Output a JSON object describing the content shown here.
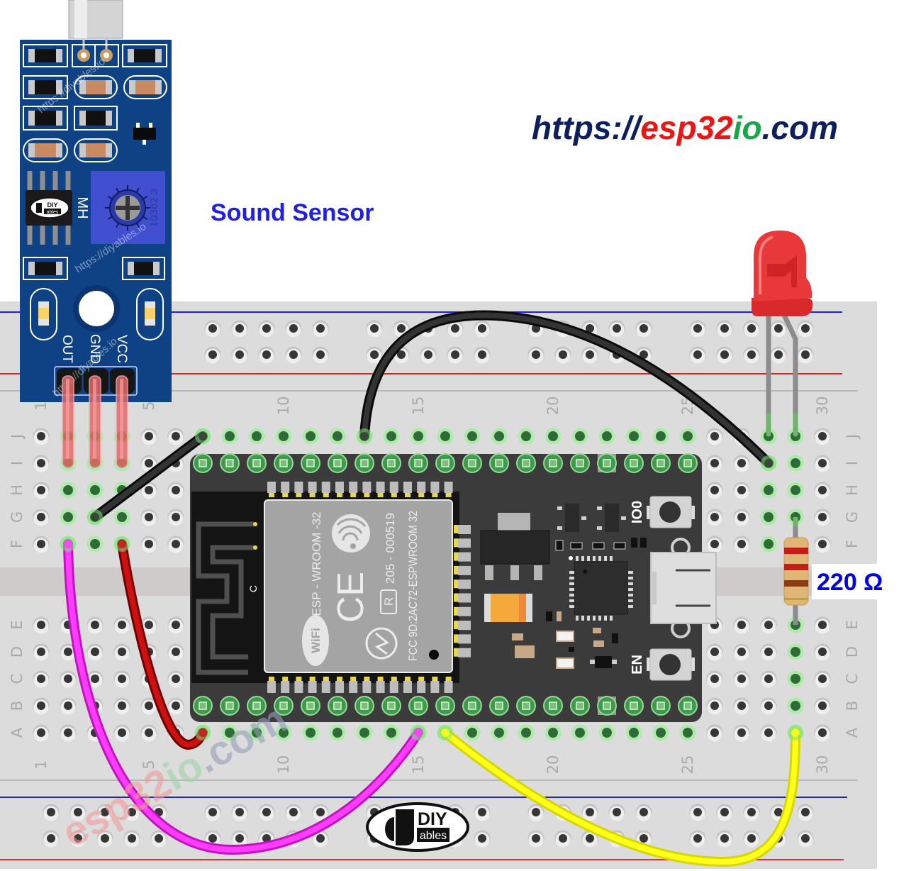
{
  "header": {
    "url": {
      "scheme": "https://",
      "brand": "esp32",
      "suffix": "io",
      "tld": ".com"
    }
  },
  "labels": {
    "sound_sensor": "Sound Sensor",
    "resistor_value": "220 Ω"
  },
  "breadboard": {
    "column_labels": [
      "1",
      "5",
      "10",
      "15",
      "20",
      "25",
      "30"
    ],
    "rows_top": [
      "J",
      "I",
      "H",
      "G",
      "F"
    ],
    "rows_bottom": [
      "E",
      "D",
      "C",
      "B",
      "A"
    ]
  },
  "sensor": {
    "pins": [
      "OUT",
      "GND",
      "VCC"
    ],
    "chip_marking": "MH",
    "pot_marking": "10362 3",
    "chip_logo": {
      "top": "DIY",
      "bottom": "ables"
    },
    "watermark": "https://diyables.io"
  },
  "esp32": {
    "module": "ESP - WROOM -32",
    "cert": "205 - 000519",
    "fcc": "FCC 9D:2AC72-ESPWROOM 32",
    "r_mark": "R",
    "ce_mark": "CE",
    "antenna_mark": "C",
    "wifi": "WiFi",
    "button_boot": "IO0",
    "button_reset": "EN"
  },
  "logo": {
    "top": "DIY",
    "bottom": "ables"
  },
  "watermark": {
    "brand": "esp32",
    "suffix": "io",
    "tld": ".com"
  },
  "circuit": {
    "sensor_pins": {
      "OUT": "I2",
      "GND": "I3",
      "VCC": "I4"
    },
    "esp32_pins": {
      "top_row": "I",
      "bottom_row": "B",
      "first_col": 7,
      "last_col": 25
    },
    "led_legs": [
      "J28",
      "J29"
    ],
    "resistor_legs": [
      "G29",
      "E29"
    ],
    "wires": [
      {
        "id": "gnd_short",
        "color": "#333333",
        "edge": "#0a0a0a",
        "from": "J7",
        "to": "G3"
      },
      {
        "id": "gnd_arc",
        "color": "#333333",
        "edge": "#0a0a0a",
        "from": "J13",
        "to": "I28"
      },
      {
        "id": "signal",
        "color": "#ff3cff",
        "edge": "#c014c0",
        "from": "F2",
        "to": "A15"
      },
      {
        "id": "power",
        "color": "#cc1111",
        "edge": "#720000",
        "from": "F4",
        "to": "A7"
      },
      {
        "id": "led",
        "color": "#ffff1a",
        "edge": "#d6d600",
        "from": "A16",
        "to": "A29"
      }
    ]
  },
  "colors": {
    "url_navy": "#0d1f5c",
    "url_red": "#ee1414",
    "url_green": "#1ba64b",
    "sensor_label": "#1f1fe8",
    "resistor_label": "#0000ee",
    "sensor_board": "#0f4285",
    "esp_board": "#3b3b3b",
    "led": "#e8383a",
    "breadboard": "#dcdcdc"
  }
}
